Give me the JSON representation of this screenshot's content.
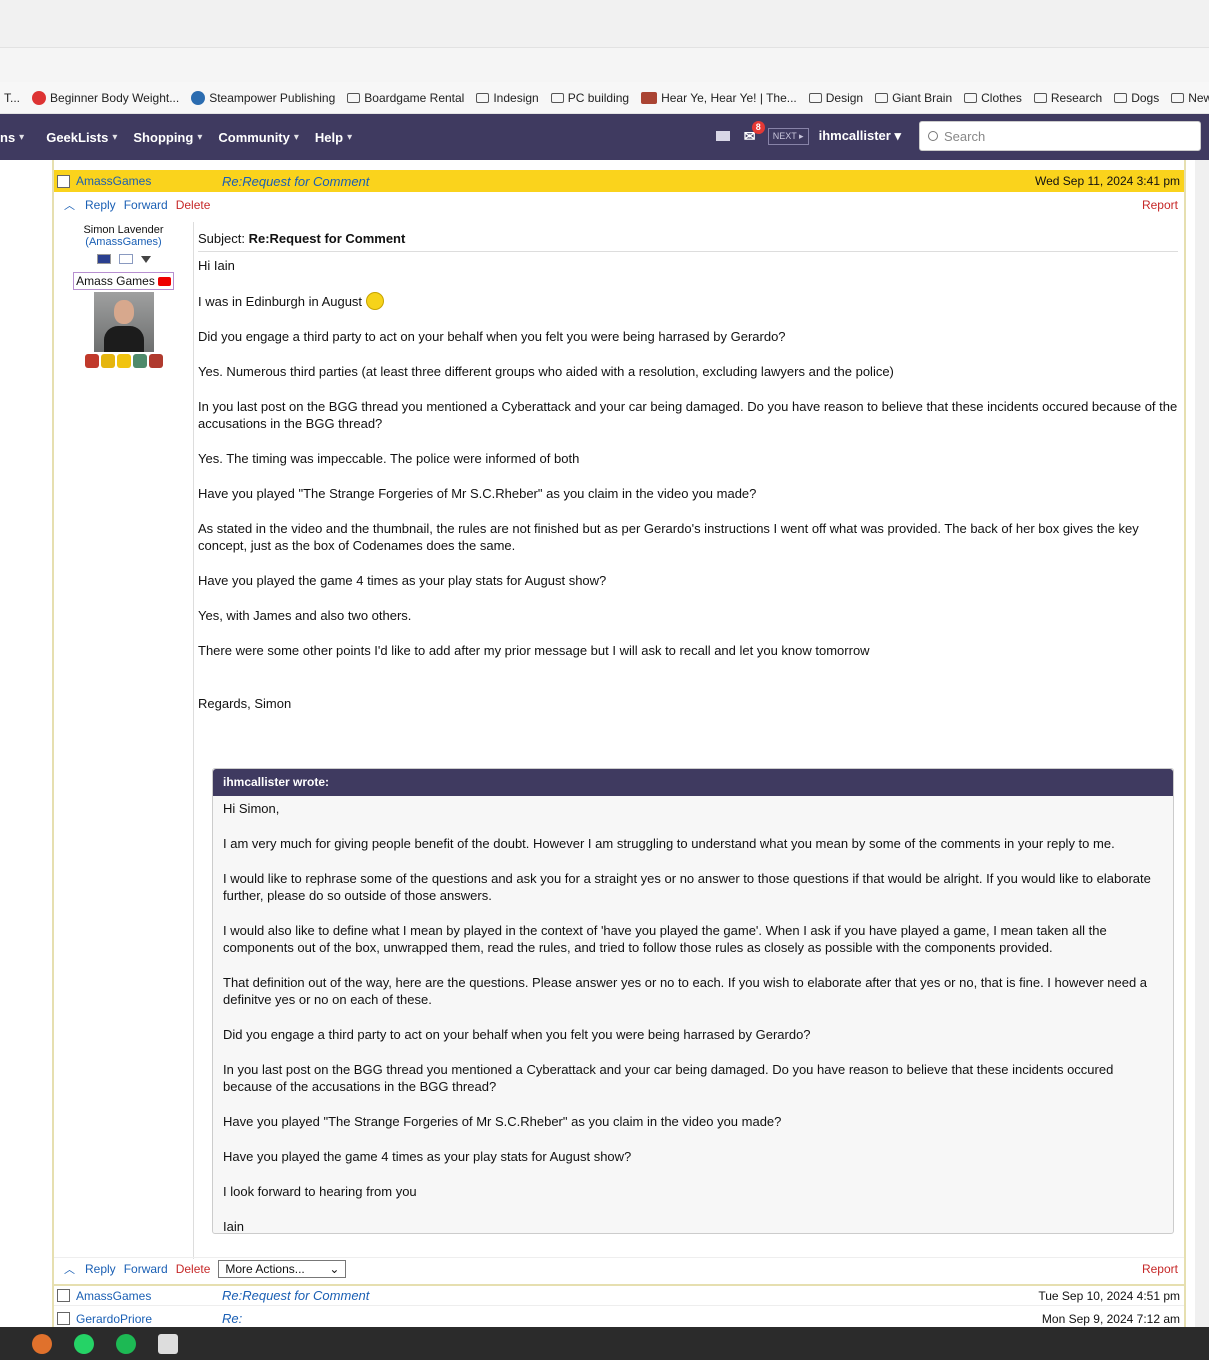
{
  "bookmarks": [
    {
      "label": "Beginner Body Weight...",
      "type": "red"
    },
    {
      "label": "Steampower Publishing",
      "type": "blue"
    },
    {
      "label": "Boardgame Rental",
      "type": "folder"
    },
    {
      "label": "Indesign",
      "type": "folder"
    },
    {
      "label": "PC building",
      "type": "folder"
    },
    {
      "label": "Hear Ye, Hear Ye! | The...",
      "type": "aeg"
    },
    {
      "label": "Design",
      "type": "folder"
    },
    {
      "label": "Giant Brain",
      "type": "folder"
    },
    {
      "label": "Clothes",
      "type": "folder"
    },
    {
      "label": "Research",
      "type": "folder"
    },
    {
      "label": "Dogs",
      "type": "folder"
    },
    {
      "label": "New folder",
      "type": "folder"
    }
  ],
  "nav": {
    "items": [
      "ns",
      "GeekLists",
      "Shopping",
      "Community",
      "Help"
    ],
    "notification_count": "8",
    "next_label": "NEXT ▸",
    "username": "ihmcallister",
    "search_placeholder": "Search"
  },
  "message": {
    "sender": "AmassGames",
    "subject_link": "Re:Request for Comment",
    "date": "Wed Sep 11, 2024 3:41 pm",
    "actions": {
      "reply": "Reply",
      "forward": "Forward",
      "delete": "Delete",
      "report": "Report",
      "more": "More Actions..."
    },
    "author": {
      "name": "Simon Lavender",
      "handle": "(AmassGames)",
      "badge": "Amass Games"
    },
    "subject_prefix": "Subject: ",
    "subject": "Re:Request for Comment",
    "paragraphs": [
      "Hi Iain",
      "I was in Edinburgh in August",
      "Did you engage a third party to act on your behalf when you felt you were being harrased by Gerardo?",
      "Yes. Numerous third parties (at least three different groups who aided with a resolution, excluding lawyers and the police)",
      "In you last post on the BGG thread you mentioned a Cyberattack and your car being damaged. Do you have reason to believe that these incidents occured because of the accusations in the BGG thread?",
      "Yes. The timing was impeccable. The police were informed of both",
      "Have you played \"The Strange Forgeries of Mr S.C.Rheber\" as you claim in the video you made?",
      "As stated in the video and the thumbnail, the rules are not finished but as per Gerardo's instructions I went off what was provided. The back of her box gives the key concept, just as the box of Codenames does the same.",
      "Have you played the game 4 times as your play stats for August show?",
      "Yes, with James and also two others.",
      "There were some other points I'd like to add after my prior message but I will ask to recall and let you know tomorrow",
      "Regards, Simon"
    ],
    "quote": {
      "header": "ihmcallister wrote:",
      "paragraphs": [
        "Hi Simon,",
        "I am very much for giving people benefit of the doubt. However I am struggling to understand what you mean by some of the comments in your reply to me.",
        "I would like to rephrase some of the questions and ask you for a straight yes or no answer to those questions if that would be alright. If you would like to elaborate further, please do so outside of those answers.",
        "I would also like to define what I mean by played in the context of 'have you played the game'. When I ask if you have played a game, I mean taken all the components out of the box, unwrapped them, read the rules, and tried to follow those rules as closely as possible with the components provided.",
        "That definition out of the way, here are the questions. Please answer yes or no to each. If you wish to elaborate after that yes or no, that is fine. I however need a definitve yes or no on each of these.",
        "Did you engage a third party to act on your behalf when you felt you were being harrased by Gerardo?",
        "In you last post on the BGG thread you mentioned a Cyberattack and your car being damaged. Do you have reason to believe that these incidents occured because of the accusations in the BGG thread?",
        "Have you played \"The Strange Forgeries of Mr S.C.Rheber\" as you claim in the video you made?",
        "Have you played the game 4 times as your play stats for August show?",
        "I look forward to hearing from you",
        "Iain"
      ]
    }
  },
  "list_rows": [
    {
      "sender": "AmassGames",
      "subject": "Re:Request for Comment",
      "date": "Tue Sep 10, 2024 4:51 pm"
    },
    {
      "sender": "GerardoPriore",
      "subject": "Re:",
      "date": "Mon Sep 9, 2024 7:12 am"
    }
  ],
  "colors": {
    "nav": "#3f3a60",
    "highlight": "#fad31c",
    "link": "#1a5fb4",
    "danger": "#c62828"
  }
}
